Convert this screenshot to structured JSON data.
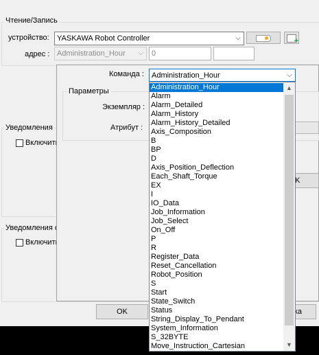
{
  "read_write": {
    "title": "Чтение/Запись",
    "device_label": "устройство:",
    "device_value": "YASKAWA Robot Controller",
    "address_label": "адрес :",
    "address_value": "Administration_Hour",
    "address_number": "0"
  },
  "notifications": {
    "title": "Уведомления",
    "enable_label": "Включить"
  },
  "invalid_input": {
    "title": "Уведомления о некорректном вводе",
    "enable_label": "Включить"
  },
  "footer": {
    "ok_label": "OK",
    "cancel_label": "ка"
  },
  "popup": {
    "command_label": "Команда :",
    "command_value": "Administration_Hour",
    "params_title": "Параметры",
    "instance_label": "Экземпляр :",
    "attribute_label": "Атрибут :",
    "side_button_label": "K",
    "options": [
      "Administration_Hour",
      "Alarm",
      "Alarm_Detailed",
      "Alarm_History",
      "Alarm_History_Detailed",
      "Axis_Composition",
      "B",
      "BP",
      "D",
      "Axis_Position_Deflection",
      "Each_Shaft_Torque",
      "EX",
      "I",
      "IO_Data",
      "Job_Information",
      "Job_Select",
      "On_Off",
      "P",
      "R",
      "Register_Data",
      "Reset_Cancellation",
      "Robot_Position",
      "S",
      "Start",
      "State_Switch",
      "Status",
      "String_Display_To_Pendant",
      "System_Information",
      "S_32BYTE",
      "Move_Instruction_Cartesian"
    ],
    "selected_index": 0
  }
}
